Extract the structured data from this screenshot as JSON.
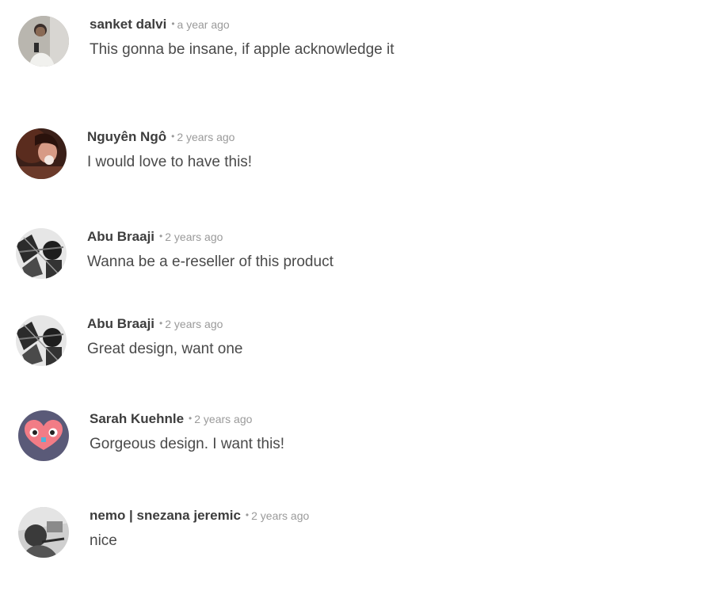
{
  "comments": [
    {
      "author": "sanket dalvi",
      "time": "a year ago",
      "text": "This gonna be insane, if apple acknowledge it"
    },
    {
      "author": "Nguyên Ngô",
      "time": "2 years ago",
      "text": "I would love to have this!"
    },
    {
      "author": "Abu Braaji",
      "time": "2 years ago",
      "text": "Wanna be a e-reseller of this product"
    },
    {
      "author": "Abu Braaji",
      "time": "2 years ago",
      "text": "Great design, want one"
    },
    {
      "author": "Sarah Kuehnle",
      "time": "2 years ago",
      "text": "Gorgeous design. I want this!"
    },
    {
      "author": "nemo | snezana jeremic",
      "time": "2 years ago",
      "text": "nice"
    }
  ],
  "separator": "•",
  "colors": {
    "author": "#3d3d3d",
    "timestamp": "#9a9a9a",
    "body": "#4a4a4a",
    "sarah_avatar_bg": "#5a5a78",
    "sarah_avatar_face": "#f27c86"
  }
}
